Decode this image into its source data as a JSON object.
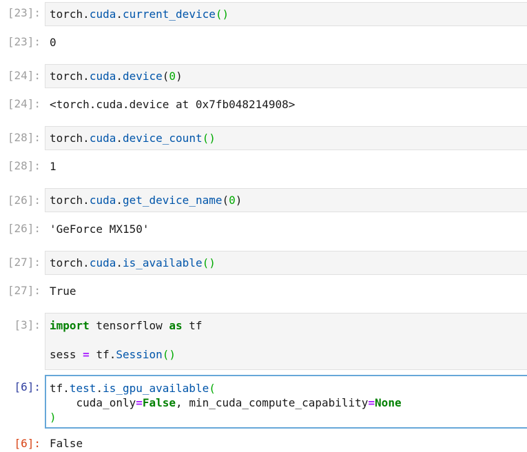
{
  "cells": [
    {
      "in_prompt": "[23]:",
      "code": [
        "torch",
        ".",
        "cuda",
        ".",
        "current_device",
        "()"
      ],
      "out_prompt": "[23]:",
      "output": "0"
    },
    {
      "in_prompt": "[24]:",
      "code": [
        "torch",
        ".",
        "cuda",
        ".",
        "device",
        "(",
        "0",
        ")"
      ],
      "out_prompt": "[24]:",
      "output": "<torch.cuda.device at 0x7fb048214908>"
    },
    {
      "in_prompt": "[28]:",
      "code": [
        "torch",
        ".",
        "cuda",
        ".",
        "device_count",
        "()"
      ],
      "out_prompt": "[28]:",
      "output": "1"
    },
    {
      "in_prompt": "[26]:",
      "code": [
        "torch",
        ".",
        "cuda",
        ".",
        "get_device_name",
        "(",
        "0",
        ")"
      ],
      "out_prompt": "[26]:",
      "output": "'GeForce MX150'"
    },
    {
      "in_prompt": "[27]:",
      "code": [
        "torch",
        ".",
        "cuda",
        ".",
        "is_available",
        "()"
      ],
      "out_prompt": "[27]:",
      "output": "True"
    },
    {
      "in_prompt": "[3]:",
      "line1": [
        "import",
        " tensorflow ",
        "as",
        " tf"
      ],
      "line2": [
        "sess ",
        "=",
        " tf.",
        "Session",
        "()"
      ]
    },
    {
      "in_prompt": "[6]:",
      "line1": [
        "tf",
        ".",
        "test",
        ".",
        "is_gpu_available",
        "("
      ],
      "line2": [
        "    cuda_only",
        "=",
        "False",
        ", min_cuda_compute_capability",
        "=",
        "None"
      ],
      "line3": [
        ")"
      ],
      "out_prompt": "[6]:",
      "output": "False"
    }
  ],
  "colors": {
    "prompt": "#9e9e9e",
    "active_in_prompt": "#303f9f",
    "active_out_prompt": "#d84315",
    "selected_border": "#66a7d8",
    "input_bg": "#f5f5f5"
  }
}
